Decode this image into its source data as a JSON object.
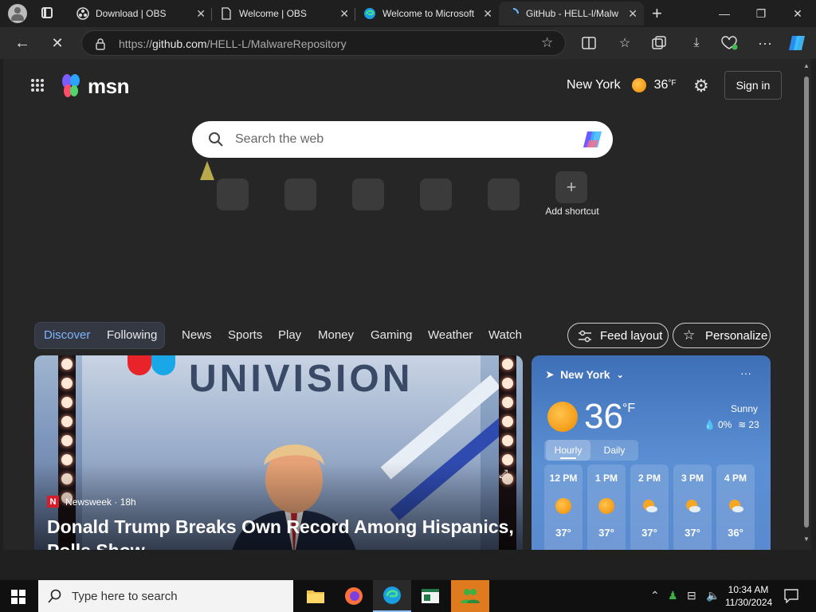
{
  "browser": {
    "tabs": [
      {
        "title": "Download | OBS",
        "icon": "obs-icon"
      },
      {
        "title": "Welcome | OBS",
        "icon": "page-icon"
      },
      {
        "title": "Welcome to Microsoft",
        "icon": "edge-icon"
      },
      {
        "title": "GitHub - HELL-l/Malw",
        "icon": "loading-icon"
      }
    ],
    "new_tab_label": "+",
    "window": {
      "minimize": "—",
      "restore": "❐",
      "close": "✕"
    },
    "address": {
      "scheme": "https://",
      "host": "github.com",
      "path": "/HELL-L/MalwareRepository"
    }
  },
  "msn": {
    "logo_text": "msn",
    "location": "New York",
    "temp": "36",
    "temp_unit": "°F",
    "sign_in": "Sign in",
    "search_placeholder": "Search the web",
    "add_shortcut": "Add shortcut",
    "nav": {
      "discover": "Discover",
      "following": "Following",
      "items": [
        "News",
        "Sports",
        "Play",
        "Money",
        "Gaming",
        "Weather",
        "Watch"
      ],
      "feed_layout": "Feed layout",
      "personalize": "Personalize"
    },
    "hero": {
      "brand_text": "UNIVISION",
      "source": "Newsweek",
      "age": "18h",
      "source_badge": "N",
      "headline": "Donald Trump Breaks Own Record Among Hispanics, Polls Show"
    },
    "weather": {
      "location": "New York",
      "temp": "36",
      "unit": "°F",
      "condition": "Sunny",
      "precip": "0%",
      "wind": "23",
      "tab_hourly": "Hourly",
      "tab_daily": "Daily",
      "more": "···",
      "hours": [
        {
          "time": "12 PM",
          "temp": "37°",
          "icon": "sun-icon"
        },
        {
          "time": "1 PM",
          "temp": "37°",
          "icon": "sun-icon"
        },
        {
          "time": "2 PM",
          "temp": "37°",
          "icon": "partly-cloudy-icon"
        },
        {
          "time": "3 PM",
          "temp": "37°",
          "icon": "partly-cloudy-icon"
        },
        {
          "time": "4 PM",
          "temp": "36°",
          "icon": "partly-cloudy-icon"
        }
      ]
    }
  },
  "taskbar": {
    "search_placeholder": "Type here to search",
    "time": "10:34 AM",
    "date": "11/30/2024"
  }
}
